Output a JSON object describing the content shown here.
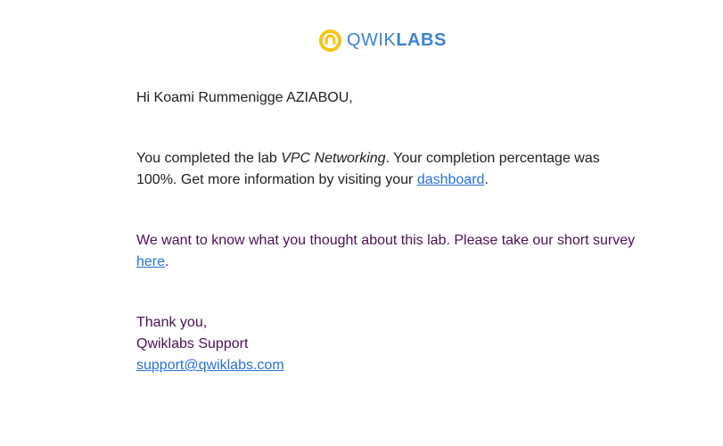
{
  "brand": {
    "name_light": "QWIK",
    "name_bold": "LABS",
    "icon": "qwiklabs-logo-icon",
    "icon_color": "#F5C518",
    "text_color": "#3B82D6"
  },
  "email": {
    "greeting": "Hi Koami Rummenigge AZIABOU,",
    "completion": {
      "part1": "You completed the lab ",
      "lab_name": "VPC Networking",
      "part2": ". Your completion percentage was 100%. Get more information by visiting your ",
      "dashboard_link": "dashboard",
      "part3": "."
    },
    "survey": {
      "part1": "We want to know what you thought about this lab. Please take our short survey ",
      "here_link": "here",
      "part2": "."
    },
    "signoff": {
      "thanks": "Thank you,",
      "team": "Qwiklabs Support",
      "email_link": "support@qwiklabs.com"
    }
  },
  "colors": {
    "link": "#2A6FD8",
    "body_text": "#202124",
    "survey_text": "#4A1250"
  }
}
